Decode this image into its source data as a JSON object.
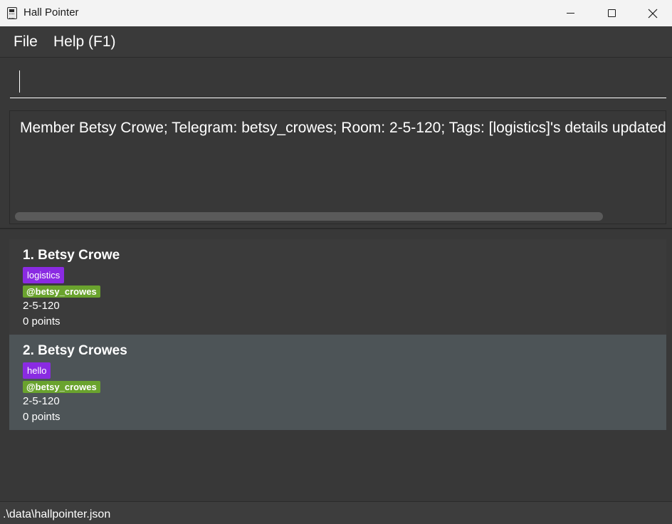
{
  "window": {
    "title": "Hall Pointer",
    "icon": "clipboard-icon"
  },
  "menu": {
    "file": "File",
    "help": "Help (F1)"
  },
  "command": {
    "value": "",
    "placeholder": ""
  },
  "result": {
    "message": "Member Betsy Crowe; Telegram: betsy_crowes; Room: 2-5-120; Tags: [logistics]'s details updated successfully."
  },
  "members": [
    {
      "title": "1. Betsy Crowe",
      "tag": "logistics",
      "telegram": "@betsy_crowes",
      "room": "2-5-120",
      "points": "0 points"
    },
    {
      "title": "2. Betsy Crowes",
      "tag": "hello",
      "telegram": "@betsy_crowes",
      "room": "2-5-120",
      "points": "0 points"
    }
  ],
  "status": {
    "path": ".\\data\\hallpointer.json"
  },
  "colors": {
    "tag": "#8a2be2",
    "telegram": "#6aa32e",
    "selected_row": "#4d5457"
  }
}
